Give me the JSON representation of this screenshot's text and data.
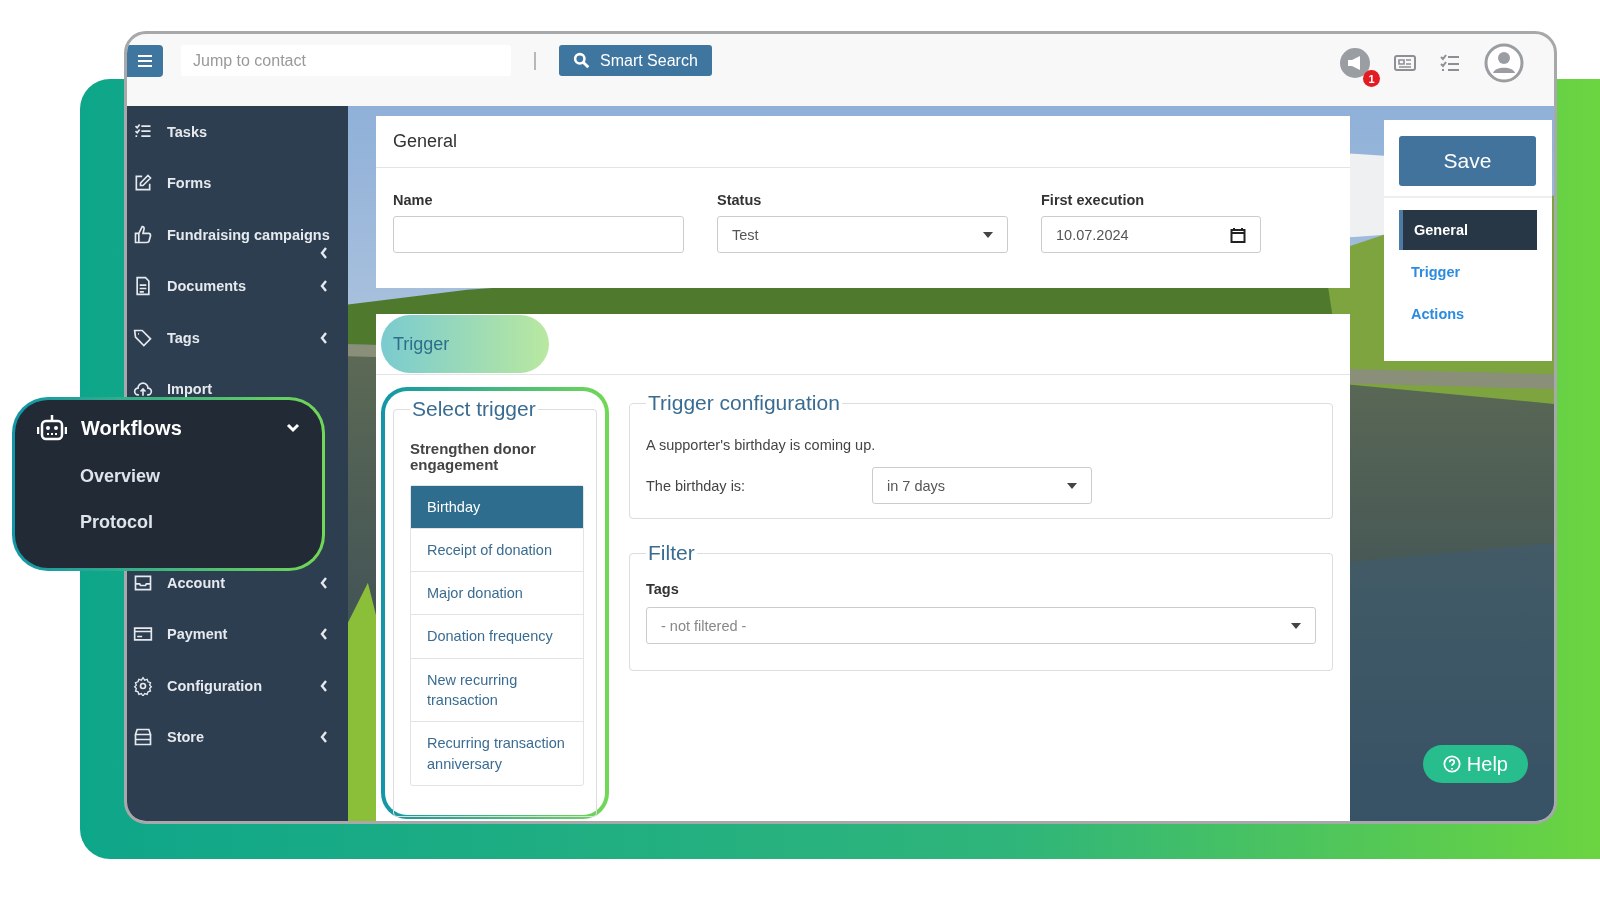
{
  "topbar": {
    "search": {
      "placeholder": "Jump to contact"
    },
    "smart_search": "Smart Search",
    "notification_badge": "1"
  },
  "sidebar": {
    "items": [
      {
        "label": "Tasks",
        "expandable": false
      },
      {
        "label": "Forms",
        "expandable": false
      },
      {
        "label": "Fundraising campaigns",
        "expandable": true
      },
      {
        "label": "Documents",
        "expandable": true
      },
      {
        "label": "Tags",
        "expandable": true
      },
      {
        "label": "Import",
        "expandable": false
      },
      {
        "label": "Account",
        "expandable": true
      },
      {
        "label": "Payment",
        "expandable": true
      },
      {
        "label": "Configuration",
        "expandable": true
      },
      {
        "label": "Store",
        "expandable": true
      }
    ]
  },
  "workflows_menu": {
    "label": "Workflows",
    "expanded": true,
    "children": [
      {
        "label": "Overview"
      },
      {
        "label": "Protocol"
      }
    ]
  },
  "general": {
    "title": "General",
    "fields": [
      {
        "kind": "text",
        "label": "Name"
      },
      {
        "kind": "select",
        "label": "Status",
        "value": "Test"
      },
      {
        "kind": "date",
        "label": "First execution",
        "value": "10.07.2024"
      }
    ]
  },
  "trigger": {
    "title": "Trigger",
    "select_trigger": {
      "legend": "Select trigger",
      "group": "Strengthen donor engagement",
      "items": [
        {
          "label": "Birthday",
          "selected": true
        },
        {
          "label": "Receipt of donation",
          "selected": false
        },
        {
          "label": "Major donation",
          "selected": false
        },
        {
          "label": "Donation frequency",
          "selected": false
        },
        {
          "label": "New recurring transaction",
          "selected": false
        },
        {
          "label": "Recurring transaction anniversary",
          "selected": false
        }
      ]
    },
    "configuration": {
      "legend": "Trigger configuration",
      "description": "A supporter's birthday is coming up.",
      "field_label": "The birthday is:",
      "field_value": "in 7 days"
    },
    "filter": {
      "legend": "Filter",
      "field_label": "Tags",
      "field_value": "- not filtered -"
    }
  },
  "side_panel": {
    "save": "Save",
    "nav": [
      {
        "label": "General",
        "selected": true
      },
      {
        "label": "Trigger",
        "selected": false
      },
      {
        "label": "Actions",
        "selected": false
      }
    ]
  },
  "help": "Help"
}
